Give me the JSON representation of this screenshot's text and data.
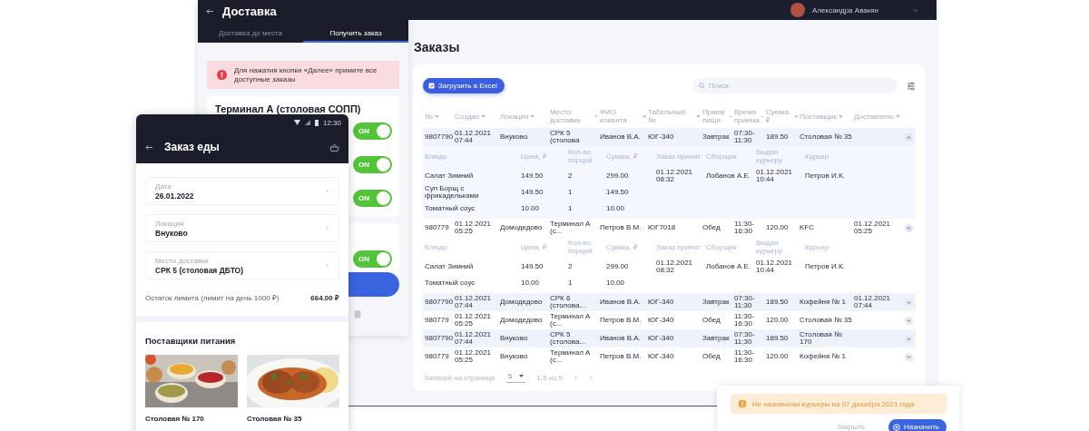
{
  "web_app": {
    "user": {
      "name": "Александра Авакян"
    },
    "page_title": "Заказы",
    "toolbar": {
      "export_button": "Загрузить в Excel",
      "search": {
        "placeholder": "Поиск"
      }
    },
    "table": {
      "columns": [
        "№",
        "Создан",
        "Локация",
        "Место доставки",
        "ФИО клиента",
        "Табельный №",
        "Прием пищи",
        "Время приема",
        "Сумма ₽",
        "Поставщик",
        "Доставлено"
      ],
      "rows": [
        {
          "cells": [
            "9807790",
            "01.12.2021 07:44",
            "Внуково",
            "СРК 5 (столова",
            "Иванов В.А.",
            "ЮГ-340",
            "Завтрак",
            "07:30-11:30",
            "189.50",
            "Столовая № 35",
            ""
          ],
          "expanded": true,
          "detail_columns": [
            "Блюдо",
            "Цена, ₽",
            "Кол-во порций",
            "Сумма, ₽",
            "Заказ принят",
            "Сборщик",
            "Выдан курьеру",
            "Курьер"
          ],
          "items": [
            {
              "cells": [
                "Салат Зимний",
                "149.50",
                "2",
                "299.00",
                "01.12.2021 08:32",
                "Лобанов А.Е.",
                "01.12.2021 10:44",
                "Петров И.К."
              ]
            },
            {
              "cells": [
                "Суп Борщ с фрикадельками",
                "149.50",
                "1",
                "149.50",
                "",
                "",
                "",
                ""
              ]
            },
            {
              "cells": [
                "Томатный соус",
                "10.00",
                "1",
                "10.00",
                "",
                "",
                "",
                ""
              ]
            }
          ]
        },
        {
          "cells": [
            "980779",
            "01.12.2021 05:25",
            "Домодедово",
            "Терминал А (с...",
            "Петров В.М.",
            "ЮГ7018",
            "Обед",
            "11:30-16:30",
            "120.00",
            "KFC",
            "01.12.2021 05:25"
          ],
          "expanded": true,
          "detail_columns": [
            "Блюдо",
            "Цена, ₽",
            "Кол-во порций",
            "Сумма, ₽",
            "Заказ принят",
            "Сборщик",
            "Выдан курьеру",
            "Курьер"
          ],
          "items": [
            {
              "cells": [
                "Салат Зимний",
                "149.50",
                "2",
                "299.00",
                "01.12.2021 08:32",
                "Лобанов А.Е.",
                "01.12.2021 10:44",
                "Петров И.К."
              ]
            },
            {
              "cells": [
                "Томатный соус",
                "10.00",
                "1",
                "10.00",
                "",
                "",
                "",
                ""
              ]
            }
          ]
        },
        {
          "cells": [
            "9807790",
            "01.12.2021 07:44",
            "Домодедово",
            "СРК 6 (столова...",
            "Иванов В.А.",
            "ЮГ-340",
            "Завтрак",
            "07:30-11:30",
            "189.50",
            "Кофейня № 1",
            "01.12.2021 07:44"
          ],
          "expanded": false
        },
        {
          "cells": [
            "980779",
            "01.12.2021 05:25",
            "Домодедово",
            "Терминал А (с...",
            "Петров В.М.",
            "ЮГ-340",
            "Обед",
            "11:30-16:30",
            "120.00",
            "Столовая № 35",
            ""
          ],
          "expanded": false
        },
        {
          "cells": [
            "9807790",
            "01.12.2021 07:44",
            "Внуково",
            "СРК 5 (столова...",
            "Иванов В.А.",
            "ЮГ-340",
            "Завтрак",
            "07:30-11:30",
            "189.50",
            "Столовая № 170",
            ""
          ],
          "expanded": false
        },
        {
          "cells": [
            "980779",
            "01.12.2021 05:25",
            "Внуково",
            "Терминал А (с...",
            "Петров В.М.",
            "ЮГ-340",
            "Обед",
            "11:30-16:30",
            "120.00",
            "Кофейня № 1",
            ""
          ],
          "expanded": false
        }
      ]
    },
    "pagination": {
      "label": "Записей на странице",
      "per_page": "5",
      "range": "1-5 из 5"
    }
  },
  "delivery_panel": {
    "title": "Доставка",
    "tabs": [
      {
        "label": "Доставка до места",
        "selected": false
      },
      {
        "label": "Получить заказ",
        "selected": true
      }
    ],
    "alert": "Для нажатия кнопки «Далее» примите все доступные заказы",
    "cards": [
      {
        "title": "Терминал А (столовая СОПП)",
        "toggles": [
          {
            "label": "ON",
            "on": true
          },
          {
            "label": "ON",
            "on": true
          },
          {
            "label": "ON",
            "on": true
          }
        ]
      },
      {
        "toggles": [
          {
            "label": "ON",
            "on": true
          }
        ]
      }
    ]
  },
  "phone": {
    "time": "12:30",
    "title": "Заказ еды",
    "fields": [
      {
        "label": "Дата",
        "value": "26.01.2022"
      },
      {
        "label": "Локация",
        "value": "Внуково"
      },
      {
        "label": "Место доставки",
        "value": "СРК 5 (столовая ДБТО)"
      }
    ],
    "limit": {
      "label": "Остаток лимита (лимит на день 1000 ₽)",
      "amount": "664.00 ₽"
    },
    "suppliers_title": "Поставщики питания",
    "suppliers": [
      {
        "name": "Столовая № 170",
        "kind": "picture"
      },
      {
        "name": "Столовая № 35",
        "kind": "picture"
      }
    ]
  },
  "notification": {
    "text": "Не назначены курьеры на 07 декабря 2021 года",
    "buttons": [
      "Закрыть",
      "Назначить"
    ]
  }
}
